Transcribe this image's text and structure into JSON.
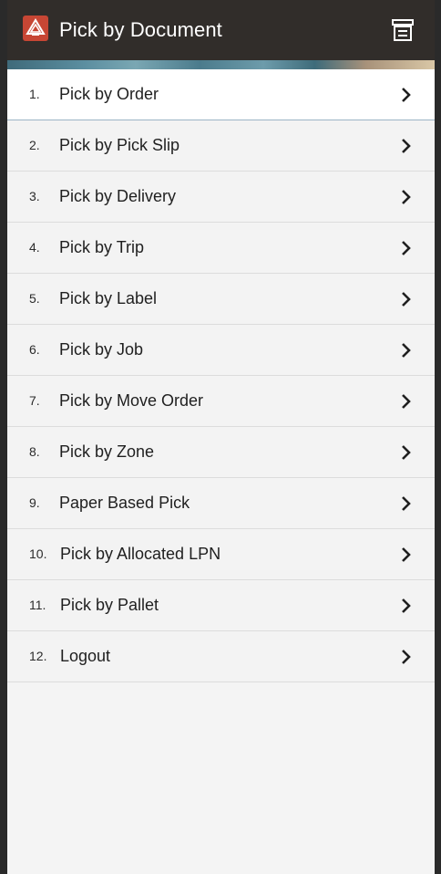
{
  "header": {
    "title": "Pick by Document",
    "logo_icon": "oracle-app-logo-icon",
    "menu_icon": "menu-drawer-icon",
    "colors": {
      "header_bg": "#312d2a",
      "logo_bg": "#c74634",
      "title_text": "#ffffff"
    }
  },
  "menu": {
    "items": [
      {
        "number": "1.",
        "label": "Pick by Order"
      },
      {
        "number": "2.",
        "label": "Pick by Pick Slip"
      },
      {
        "number": "3.",
        "label": "Pick by Delivery"
      },
      {
        "number": "4.",
        "label": "Pick by Trip"
      },
      {
        "number": "5.",
        "label": "Pick by Label"
      },
      {
        "number": "6.",
        "label": "Pick by Job"
      },
      {
        "number": "7.",
        "label": "Pick by Move Order"
      },
      {
        "number": "8.",
        "label": "Pick by Zone"
      },
      {
        "number": "9.",
        "label": "Paper Based Pick"
      },
      {
        "number": "10.",
        "label": "Pick by Allocated LPN"
      },
      {
        "number": "11.",
        "label": "Pick by Pallet"
      },
      {
        "number": "12.",
        "label": "Logout"
      }
    ],
    "item_icon": "chevron-right-icon"
  }
}
